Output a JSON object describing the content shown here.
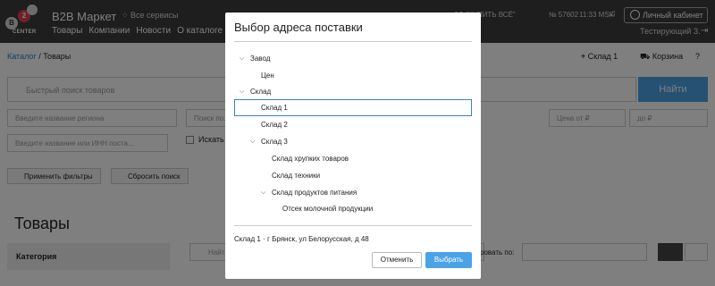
{
  "header": {
    "logo_letters": [
      "B",
      "2"
    ],
    "logo_sub": "CENTER",
    "brand": "B2B Маркет",
    "services": "Все сервисы",
    "nav": [
      "Товары",
      "Компании",
      "Новости",
      "О каталоге"
    ],
    "company": "ЗО \"КУПИТЬ ВСЁ\"",
    "number": "№ 57602",
    "time": "11:33 MSK",
    "cabinet": "Личный кабинет",
    "user": "Тестирующий З."
  },
  "breadcrumb": {
    "root": "Каталог",
    "sep": "/",
    "current": "Товары"
  },
  "toolbar": {
    "warehouse": "Склад 1",
    "cart": "Корзина",
    "help": "?"
  },
  "search": {
    "placeholder": "Быстрый поиск товаров",
    "button": "Найти"
  },
  "filters": {
    "region": "Введите название региона",
    "search_by": "Поиск по...",
    "price_from": "Цена от ₽",
    "price_to": "до ₽",
    "company": "Введите название или ИНН поста...",
    "checkbox_label": "Искать т",
    "apply": "Применить фильтры",
    "reset": "Сбросить поиск"
  },
  "page": {
    "title": "Товары",
    "category_label": "Категория",
    "filter_input": "Найти",
    "sort_label": "ровать по:"
  },
  "modal": {
    "title": "Выбор адреса поставки",
    "tree": [
      {
        "label": "Завод",
        "expanded": true,
        "level": 0
      },
      {
        "label": "Цен",
        "level": 1
      },
      {
        "label": "Склад",
        "expanded": true,
        "level": 0
      },
      {
        "label": "Склад 1",
        "level": 1,
        "selected": true
      },
      {
        "label": "Склад 2",
        "level": 1
      },
      {
        "label": "Склад 3",
        "expanded": true,
        "level": 1
      },
      {
        "label": "Склад хрупких товаров",
        "level": 2
      },
      {
        "label": "Склад техники",
        "level": 2
      },
      {
        "label": "Склад продуктов питания",
        "expanded": true,
        "level": 2
      },
      {
        "label": "Отсек молочной продукции",
        "level": 3
      }
    ],
    "selected_warehouse": "Склад 1",
    "selected_dot": "·",
    "selected_address": "г Брянск, ул Белорусская, д 48",
    "cancel": "Отменить",
    "ok": "Выбрать"
  },
  "colors": {
    "accent": "#4aa3e6",
    "header_bg": "#3c3c3c",
    "logo_red": "#e0434a"
  }
}
